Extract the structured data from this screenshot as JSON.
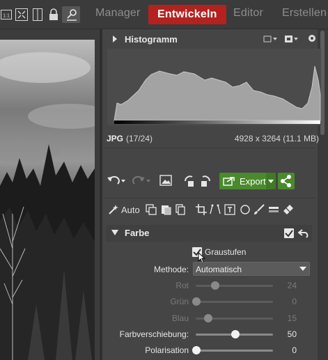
{
  "toolbar": {
    "icons": [
      "one-to-one-zoom-icon",
      "fit-screen-icon",
      "compare-icon",
      "lock-icon",
      "search-user-icon"
    ],
    "one_to_one_label": "1:1"
  },
  "mode_tabs": [
    {
      "label": "Manager",
      "active": false
    },
    {
      "label": "Entwickeln",
      "active": true
    },
    {
      "label": "Editor",
      "active": false
    },
    {
      "label": "Erstellen",
      "active": false
    }
  ],
  "histogram": {
    "title": "Histogramm",
    "header_icons": [
      "crop-guide-icon",
      "clipping-icon",
      "settings-icon"
    ]
  },
  "file": {
    "type": "JPG",
    "count": "(17/24)",
    "info": "4928 x 3264 (11.1 MB)"
  },
  "actions": {
    "export_label": "Export",
    "icons": [
      "undo-icon",
      "redo-icon",
      "image-icon",
      "rotate-left-icon",
      "rotate-right-icon",
      "share-icon"
    ]
  },
  "tools": {
    "auto_label": "Auto",
    "icons": [
      "wand-icon",
      "copy-icon",
      "paste-icon",
      "duplicate-icon",
      "crop-icon",
      "perspective-icon",
      "text-icon",
      "circle-mask-icon",
      "brush-icon",
      "gradient-icon",
      "eraser-icon"
    ]
  },
  "farbe": {
    "title": "Farbe",
    "enabled": true,
    "grayscale_label": "Graustufen",
    "grayscale_checked": true,
    "method_label": "Methode:",
    "method_value": "Automatisch",
    "sliders": [
      {
        "label": "Rot",
        "value": "24",
        "fraction": 0.24,
        "enabled": false
      },
      {
        "label": "Grün",
        "value": "0",
        "fraction": 0.0,
        "enabled": false
      },
      {
        "label": "Blau",
        "value": "15",
        "fraction": 0.15,
        "enabled": false
      },
      {
        "label": "Farbverschiebung:",
        "value": "50",
        "fraction": 0.5,
        "enabled": true
      },
      {
        "label": "Polarisation",
        "value": "0",
        "fraction": 0.0,
        "enabled": true
      }
    ]
  },
  "colors": {
    "accent_red": "#b3221f",
    "export_green": "#4a8a2d",
    "panel_bg": "#454545"
  }
}
